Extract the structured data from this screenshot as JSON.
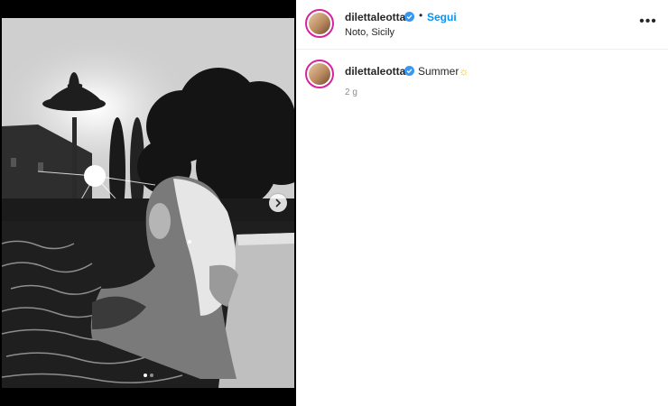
{
  "post": {
    "username": "dilettaleotta",
    "follow_label": "Segui",
    "separator": "•",
    "location": "Noto, Sicily",
    "more_label": "•••",
    "caption_text": "Summer",
    "caption_emoji": "☼",
    "time_ago": "2 g"
  },
  "carousel": {
    "current_index": 1,
    "total": 2,
    "next_icon": "chevron-right-icon"
  },
  "colors": {
    "link": "#0095f6",
    "verified": "#3897f0",
    "story_ring": "#d6249f",
    "text": "#262626",
    "muted": "#8e8e8e"
  }
}
